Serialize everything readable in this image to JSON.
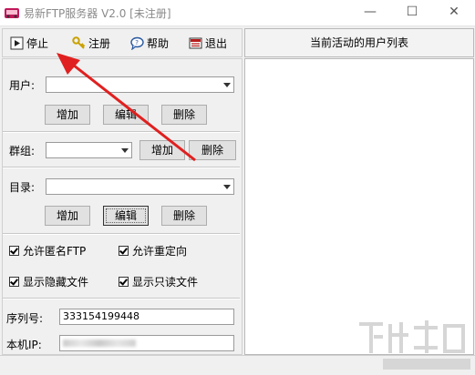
{
  "window": {
    "title": "易新FTP服务器 V2.0 [未注册]",
    "minimize": "—",
    "maximize": "☐",
    "close": "✕"
  },
  "toolbar": {
    "stop": "停止",
    "register": "注册",
    "help": "帮助",
    "exit": "退出"
  },
  "right_panel": {
    "header": "当前活动的用户列表"
  },
  "form": {
    "user_label": "用户:",
    "user_value": "",
    "group_label": "群组:",
    "group_value": "",
    "dir_label": "目录:",
    "dir_value": "",
    "add": "增加",
    "edit": "编辑",
    "delete": "删除"
  },
  "options": {
    "anon": {
      "label": "允许匿名FTP",
      "checked": true
    },
    "redirect": {
      "label": "允许重定向",
      "checked": true
    },
    "hidden": {
      "label": "显示隐藏文件",
      "checked": true
    },
    "readonly": {
      "label": "显示只读文件",
      "checked": true
    }
  },
  "info": {
    "serial_label": "序列号:",
    "serial_value": "333154199448",
    "ip_label": "本机IP:"
  },
  "colors": {
    "annotation_arrow": "#e02020",
    "title_text": "#8a8a8a"
  }
}
